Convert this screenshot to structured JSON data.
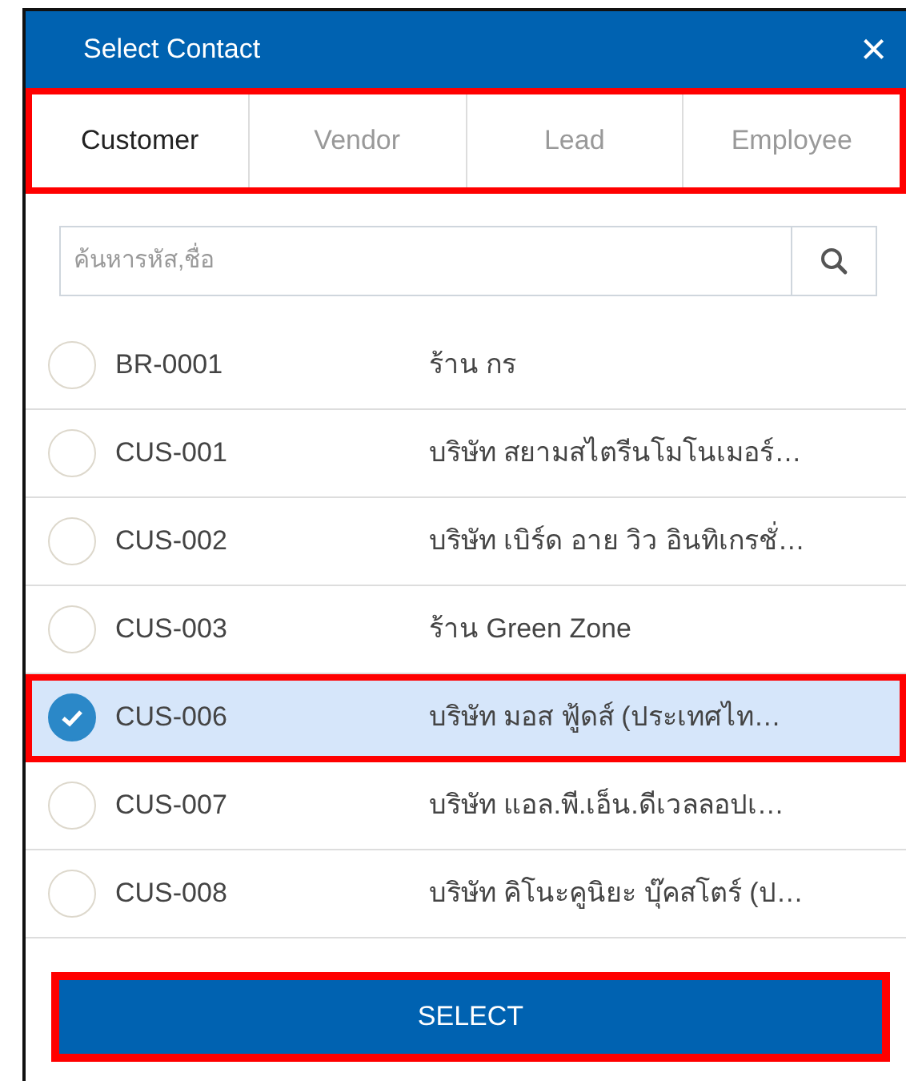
{
  "dialog": {
    "title": "Select Contact",
    "close_icon": "×"
  },
  "tabs_highlighted": true,
  "tabs": [
    {
      "label": "Customer",
      "selected": true
    },
    {
      "label": "Vendor",
      "selected": false
    },
    {
      "label": "Lead",
      "selected": false
    },
    {
      "label": "Employee",
      "selected": false
    }
  ],
  "search": {
    "placeholder": "ค้นหารหัส,ชื่อ"
  },
  "contacts": [
    {
      "code": "BR-0001",
      "name": "ร้าน กร",
      "selected": false
    },
    {
      "code": "CUS-001",
      "name": "บริษัท สยามสไตรีนโมโนเมอร์…",
      "selected": false
    },
    {
      "code": "CUS-002",
      "name": "บริษัท เบิร์ด อาย วิว อินทิเกรชั่…",
      "selected": false
    },
    {
      "code": "CUS-003",
      "name": "ร้าน Green Zone",
      "selected": false
    },
    {
      "code": "CUS-006",
      "name": "บริษัท มอส ฟู้ดส์ (ประเทศไท…",
      "selected": true
    },
    {
      "code": "CUS-007",
      "name": "บริษัท แอล.พี.เอ็น.ดีเวลลอปเ…",
      "selected": false
    },
    {
      "code": "CUS-008",
      "name": "บริษัท คิโนะคูนิยะ บุ๊คสโตร์ (ป…",
      "selected": false
    }
  ],
  "select_button": {
    "label": "SELECT",
    "highlighted": true
  }
}
